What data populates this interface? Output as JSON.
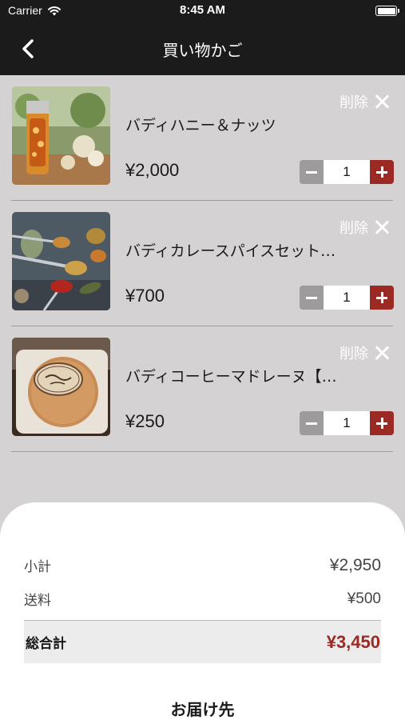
{
  "status_bar": {
    "carrier": "Carrier",
    "time": "8:45 AM"
  },
  "nav": {
    "title": "買い物かご",
    "back_icon": "chevron-left-icon"
  },
  "colors": {
    "header_bg": "#1b1b1b",
    "list_bg": "#d4d2d3",
    "accent": "#9c2a24",
    "minus_bg": "#9d9b9b"
  },
  "cart": {
    "delete_label": "削除",
    "items": [
      {
        "name": "バディハニー＆ナッツ",
        "price": "¥2,000",
        "quantity": "1"
      },
      {
        "name": "バディカレースパイスセット…",
        "price": "¥700",
        "quantity": "1"
      },
      {
        "name": "バディコーヒーマドレーヌ【…",
        "price": "¥250",
        "quantity": "1"
      }
    ]
  },
  "summary": {
    "subtotal_label": "小計",
    "subtotal_value": "¥2,950",
    "shipping_label": "送料",
    "shipping_value": "¥500",
    "total_label": "総合計",
    "total_value": "¥3,450"
  },
  "delivery_label": "お届け先"
}
